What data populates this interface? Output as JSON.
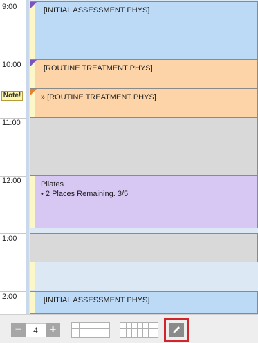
{
  "times": [
    "9:00",
    "10:00",
    "11:00",
    "12:00",
    "1:00",
    "2:00"
  ],
  "note_badge": "Note!",
  "appointments": [
    {
      "text": "[INITIAL ASSESSMENT PHYS]"
    },
    {
      "text": "[ROUTINE TREATMENT PHYS]"
    },
    {
      "text": "» [ROUTINE TREATMENT PHYS]"
    },
    {
      "text": ""
    },
    {
      "title": "Pilates",
      "detail": "• 2 Places Remaining. 3/5"
    },
    {
      "text": ""
    },
    {
      "text": "[INITIAL ASSESSMENT PHYS]"
    }
  ],
  "toolbar": {
    "minus_label": "−",
    "count_value": "4",
    "plus_label": "+"
  },
  "colors": {
    "blue_appt": "#bcd9f5",
    "orange_appt": "#fdd3a8",
    "grey_block": "#d9d9d9",
    "purple_class": "#d6c8f2",
    "corner_purple": "#7a52c2",
    "corner_orange": "#e8822a",
    "highlight_red": "#d0252a"
  }
}
